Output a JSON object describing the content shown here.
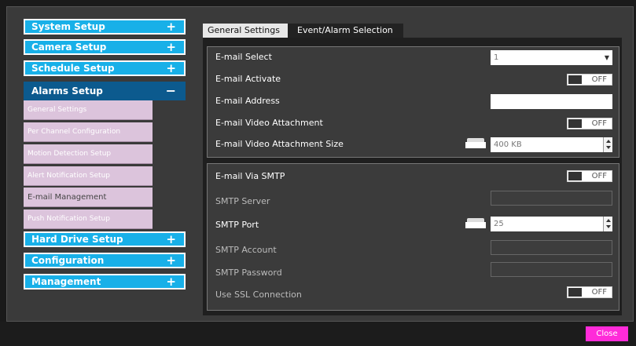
{
  "sidebar": {
    "sections": [
      {
        "label": "System Setup",
        "icon": "+"
      },
      {
        "label": "Camera Setup",
        "icon": "+"
      },
      {
        "label": "Schedule Setup",
        "icon": "+"
      },
      {
        "label": "Alarms Setup",
        "icon": "−"
      },
      {
        "label": "Hard Drive Setup",
        "icon": "+"
      },
      {
        "label": "Configuration",
        "icon": "+"
      },
      {
        "label": "Management",
        "icon": "+"
      }
    ],
    "alarms_items": [
      "General Settings",
      "Per Channel Configuration",
      "Motion Detection Setup",
      "Alert Notification Setup",
      "E-mail Management",
      "Push Notification Setup"
    ]
  },
  "tabs": [
    "General Settings",
    "Event/Alarm Selection"
  ],
  "email": {
    "select_label": "E-mail Select",
    "select_value": "1",
    "activate_label": "E-mail Activate",
    "address_label": "E-mail Address",
    "video_attach_label": "E-mail Video Attachment",
    "video_attach_size_label": "E-mail Video Attachment Size",
    "video_attach_size_value": "400 KB"
  },
  "smtp": {
    "via_label": "E-mail Via SMTP",
    "server_label": "SMTP Server",
    "port_label": "SMTP Port",
    "port_value": "25",
    "account_label": "SMTP Account",
    "password_label": "SMTP Password",
    "ssl_label": "Use SSL Connection"
  },
  "toggle_off": "OFF",
  "close_label": "Close",
  "colors": {
    "accent": "#18b0e8",
    "active": "#0c5a8e",
    "close": "#ff2bd9",
    "submenu": "#dcc4dc"
  }
}
